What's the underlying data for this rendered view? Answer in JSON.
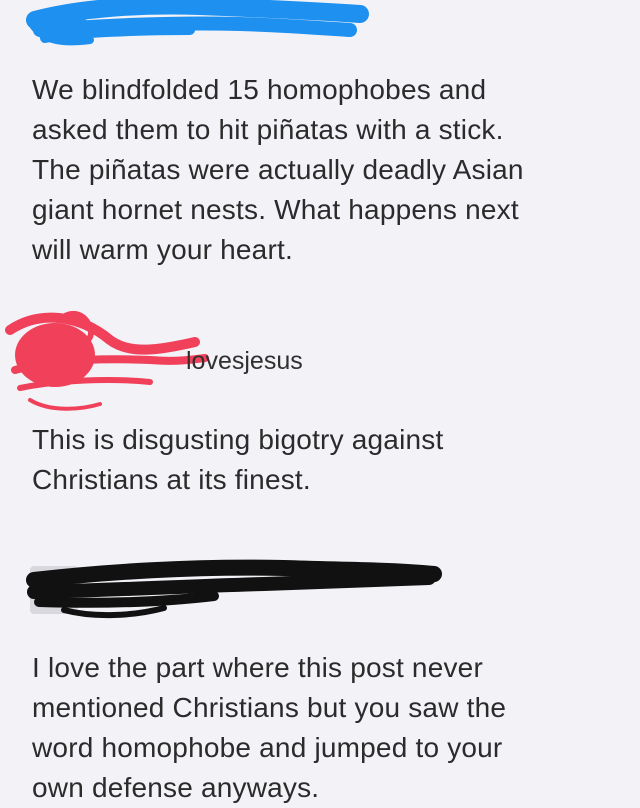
{
  "post": {
    "text": "We blindfolded 15 homophobes and\nasked them to hit piñatas with a stick.\nThe piñatas were actually deadly Asian\ngiant hornet nests. What happens next\nwill warm your heart."
  },
  "comments": [
    {
      "username": "lovesjesus",
      "text": "This is disgusting bigotry against\nChristians at its finest."
    },
    {
      "username": "",
      "text": "I love the part where this post never\nmentioned Christians but you saw the\nword homophobe and jumped to your\nown defense anyways."
    }
  ],
  "colors": {
    "background": "#f2f2f7",
    "text": "#2b2b2b",
    "blue_scribble": "#1e90f0",
    "red_scribble": "#f0405a",
    "black_scribble": "#111111"
  }
}
